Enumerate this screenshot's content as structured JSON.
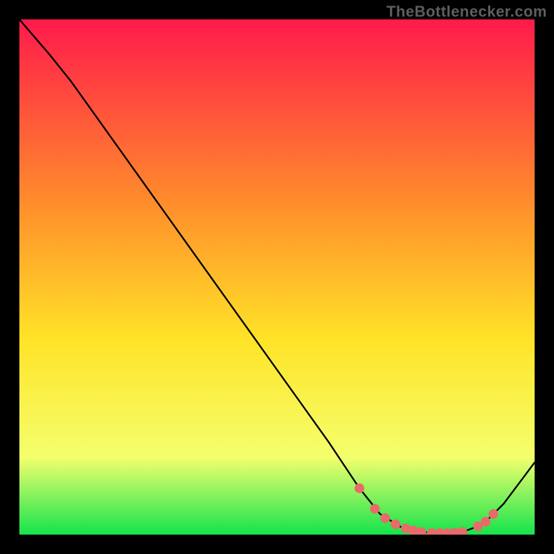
{
  "watermark": "TheBottlenecker.com",
  "colors": {
    "bg": "#000000",
    "line": "#000000",
    "marker": "#e96a6a",
    "marker_stroke": "#e96a6a",
    "gradient_top": "#ff1a4b",
    "gradient_mid1": "#ff8b2c",
    "gradient_mid2": "#ffe327",
    "gradient_mid3": "#f4ff6d",
    "gradient_bottom": "#15e34c"
  },
  "chart_data": {
    "type": "line",
    "title": "",
    "xlabel": "",
    "ylabel": "",
    "xlim": [
      0,
      100
    ],
    "ylim": [
      0,
      100
    ],
    "series": [
      {
        "name": "bottleneck-curve",
        "x": [
          0,
          6,
          10,
          20,
          30,
          40,
          50,
          60,
          66,
          70,
          74,
          78,
          82,
          86,
          90,
          94,
          100
        ],
        "y": [
          100,
          93,
          88,
          74,
          60,
          46,
          32,
          18,
          9,
          4,
          1.5,
          0.5,
          0.3,
          0.5,
          2,
          6,
          14
        ]
      }
    ],
    "markers": {
      "name": "highlighted-points",
      "x": [
        66,
        69,
        71,
        73,
        75,
        76.5,
        78,
        80,
        81.5,
        83,
        84.5,
        86,
        89,
        90.5,
        92
      ],
      "y": [
        9,
        5,
        3.2,
        2,
        1.2,
        0.8,
        0.5,
        0.3,
        0.3,
        0.3,
        0.4,
        0.5,
        1.6,
        2.5,
        4
      ]
    }
  }
}
